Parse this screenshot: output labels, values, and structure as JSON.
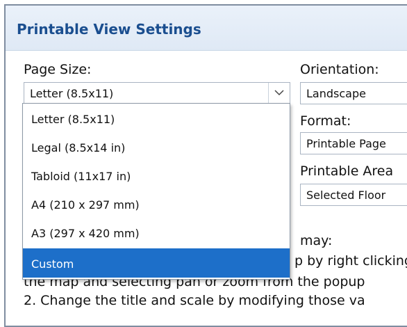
{
  "panel": {
    "title": "Printable View Settings"
  },
  "page_size": {
    "label": "Page Size:",
    "value": "Letter (8.5x11)",
    "options": [
      "Letter (8.5x11)",
      "Legal (8.5x14 in)",
      "Tabloid (11x17 in)",
      "A4 (210 x 297 mm)",
      "A3 (297 x 420 mm)",
      "Custom"
    ],
    "highlighted": "Custom"
  },
  "orientation": {
    "label": "Orientation:",
    "value": "Landscape"
  },
  "format": {
    "label": "Format:",
    "value": "Printable Page"
  },
  "printable_area": {
    "label": "Printable Area",
    "value": "Selected Floor"
  },
  "instructions": {
    "line1": "may:",
    "line2": "p by right clicking",
    "line3": "the map and selecting pan or zoom from the popup",
    "line4": "2. Change the title and scale by modifying those va"
  },
  "colors": {
    "title": "#1a4e8f",
    "selection": "#1d6fc9"
  }
}
